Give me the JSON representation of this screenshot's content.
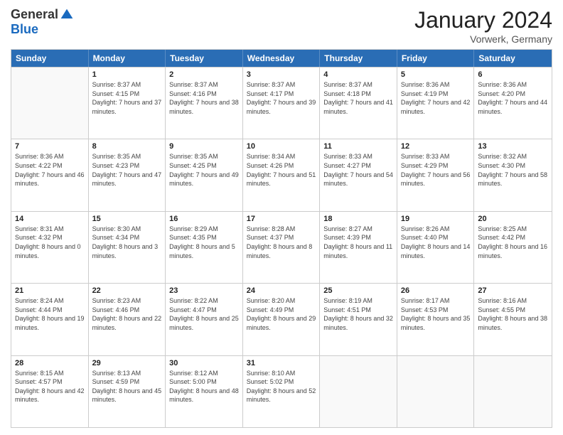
{
  "logo": {
    "general": "General",
    "blue": "Blue"
  },
  "title": "January 2024",
  "location": "Vorwerk, Germany",
  "days_header": [
    "Sunday",
    "Monday",
    "Tuesday",
    "Wednesday",
    "Thursday",
    "Friday",
    "Saturday"
  ],
  "weeks": [
    [
      {
        "day": "",
        "sunrise": "",
        "sunset": "",
        "daylight": ""
      },
      {
        "day": "1",
        "sunrise": "Sunrise: 8:37 AM",
        "sunset": "Sunset: 4:15 PM",
        "daylight": "Daylight: 7 hours and 37 minutes."
      },
      {
        "day": "2",
        "sunrise": "Sunrise: 8:37 AM",
        "sunset": "Sunset: 4:16 PM",
        "daylight": "Daylight: 7 hours and 38 minutes."
      },
      {
        "day": "3",
        "sunrise": "Sunrise: 8:37 AM",
        "sunset": "Sunset: 4:17 PM",
        "daylight": "Daylight: 7 hours and 39 minutes."
      },
      {
        "day": "4",
        "sunrise": "Sunrise: 8:37 AM",
        "sunset": "Sunset: 4:18 PM",
        "daylight": "Daylight: 7 hours and 41 minutes."
      },
      {
        "day": "5",
        "sunrise": "Sunrise: 8:36 AM",
        "sunset": "Sunset: 4:19 PM",
        "daylight": "Daylight: 7 hours and 42 minutes."
      },
      {
        "day": "6",
        "sunrise": "Sunrise: 8:36 AM",
        "sunset": "Sunset: 4:20 PM",
        "daylight": "Daylight: 7 hours and 44 minutes."
      }
    ],
    [
      {
        "day": "7",
        "sunrise": "Sunrise: 8:36 AM",
        "sunset": "Sunset: 4:22 PM",
        "daylight": "Daylight: 7 hours and 46 minutes."
      },
      {
        "day": "8",
        "sunrise": "Sunrise: 8:35 AM",
        "sunset": "Sunset: 4:23 PM",
        "daylight": "Daylight: 7 hours and 47 minutes."
      },
      {
        "day": "9",
        "sunrise": "Sunrise: 8:35 AM",
        "sunset": "Sunset: 4:25 PM",
        "daylight": "Daylight: 7 hours and 49 minutes."
      },
      {
        "day": "10",
        "sunrise": "Sunrise: 8:34 AM",
        "sunset": "Sunset: 4:26 PM",
        "daylight": "Daylight: 7 hours and 51 minutes."
      },
      {
        "day": "11",
        "sunrise": "Sunrise: 8:33 AM",
        "sunset": "Sunset: 4:27 PM",
        "daylight": "Daylight: 7 hours and 54 minutes."
      },
      {
        "day": "12",
        "sunrise": "Sunrise: 8:33 AM",
        "sunset": "Sunset: 4:29 PM",
        "daylight": "Daylight: 7 hours and 56 minutes."
      },
      {
        "day": "13",
        "sunrise": "Sunrise: 8:32 AM",
        "sunset": "Sunset: 4:30 PM",
        "daylight": "Daylight: 7 hours and 58 minutes."
      }
    ],
    [
      {
        "day": "14",
        "sunrise": "Sunrise: 8:31 AM",
        "sunset": "Sunset: 4:32 PM",
        "daylight": "Daylight: 8 hours and 0 minutes."
      },
      {
        "day": "15",
        "sunrise": "Sunrise: 8:30 AM",
        "sunset": "Sunset: 4:34 PM",
        "daylight": "Daylight: 8 hours and 3 minutes."
      },
      {
        "day": "16",
        "sunrise": "Sunrise: 8:29 AM",
        "sunset": "Sunset: 4:35 PM",
        "daylight": "Daylight: 8 hours and 5 minutes."
      },
      {
        "day": "17",
        "sunrise": "Sunrise: 8:28 AM",
        "sunset": "Sunset: 4:37 PM",
        "daylight": "Daylight: 8 hours and 8 minutes."
      },
      {
        "day": "18",
        "sunrise": "Sunrise: 8:27 AM",
        "sunset": "Sunset: 4:39 PM",
        "daylight": "Daylight: 8 hours and 11 minutes."
      },
      {
        "day": "19",
        "sunrise": "Sunrise: 8:26 AM",
        "sunset": "Sunset: 4:40 PM",
        "daylight": "Daylight: 8 hours and 14 minutes."
      },
      {
        "day": "20",
        "sunrise": "Sunrise: 8:25 AM",
        "sunset": "Sunset: 4:42 PM",
        "daylight": "Daylight: 8 hours and 16 minutes."
      }
    ],
    [
      {
        "day": "21",
        "sunrise": "Sunrise: 8:24 AM",
        "sunset": "Sunset: 4:44 PM",
        "daylight": "Daylight: 8 hours and 19 minutes."
      },
      {
        "day": "22",
        "sunrise": "Sunrise: 8:23 AM",
        "sunset": "Sunset: 4:46 PM",
        "daylight": "Daylight: 8 hours and 22 minutes."
      },
      {
        "day": "23",
        "sunrise": "Sunrise: 8:22 AM",
        "sunset": "Sunset: 4:47 PM",
        "daylight": "Daylight: 8 hours and 25 minutes."
      },
      {
        "day": "24",
        "sunrise": "Sunrise: 8:20 AM",
        "sunset": "Sunset: 4:49 PM",
        "daylight": "Daylight: 8 hours and 29 minutes."
      },
      {
        "day": "25",
        "sunrise": "Sunrise: 8:19 AM",
        "sunset": "Sunset: 4:51 PM",
        "daylight": "Daylight: 8 hours and 32 minutes."
      },
      {
        "day": "26",
        "sunrise": "Sunrise: 8:17 AM",
        "sunset": "Sunset: 4:53 PM",
        "daylight": "Daylight: 8 hours and 35 minutes."
      },
      {
        "day": "27",
        "sunrise": "Sunrise: 8:16 AM",
        "sunset": "Sunset: 4:55 PM",
        "daylight": "Daylight: 8 hours and 38 minutes."
      }
    ],
    [
      {
        "day": "28",
        "sunrise": "Sunrise: 8:15 AM",
        "sunset": "Sunset: 4:57 PM",
        "daylight": "Daylight: 8 hours and 42 minutes."
      },
      {
        "day": "29",
        "sunrise": "Sunrise: 8:13 AM",
        "sunset": "Sunset: 4:59 PM",
        "daylight": "Daylight: 8 hours and 45 minutes."
      },
      {
        "day": "30",
        "sunrise": "Sunrise: 8:12 AM",
        "sunset": "Sunset: 5:00 PM",
        "daylight": "Daylight: 8 hours and 48 minutes."
      },
      {
        "day": "31",
        "sunrise": "Sunrise: 8:10 AM",
        "sunset": "Sunset: 5:02 PM",
        "daylight": "Daylight: 8 hours and 52 minutes."
      },
      {
        "day": "",
        "sunrise": "",
        "sunset": "",
        "daylight": ""
      },
      {
        "day": "",
        "sunrise": "",
        "sunset": "",
        "daylight": ""
      },
      {
        "day": "",
        "sunrise": "",
        "sunset": "",
        "daylight": ""
      }
    ]
  ]
}
